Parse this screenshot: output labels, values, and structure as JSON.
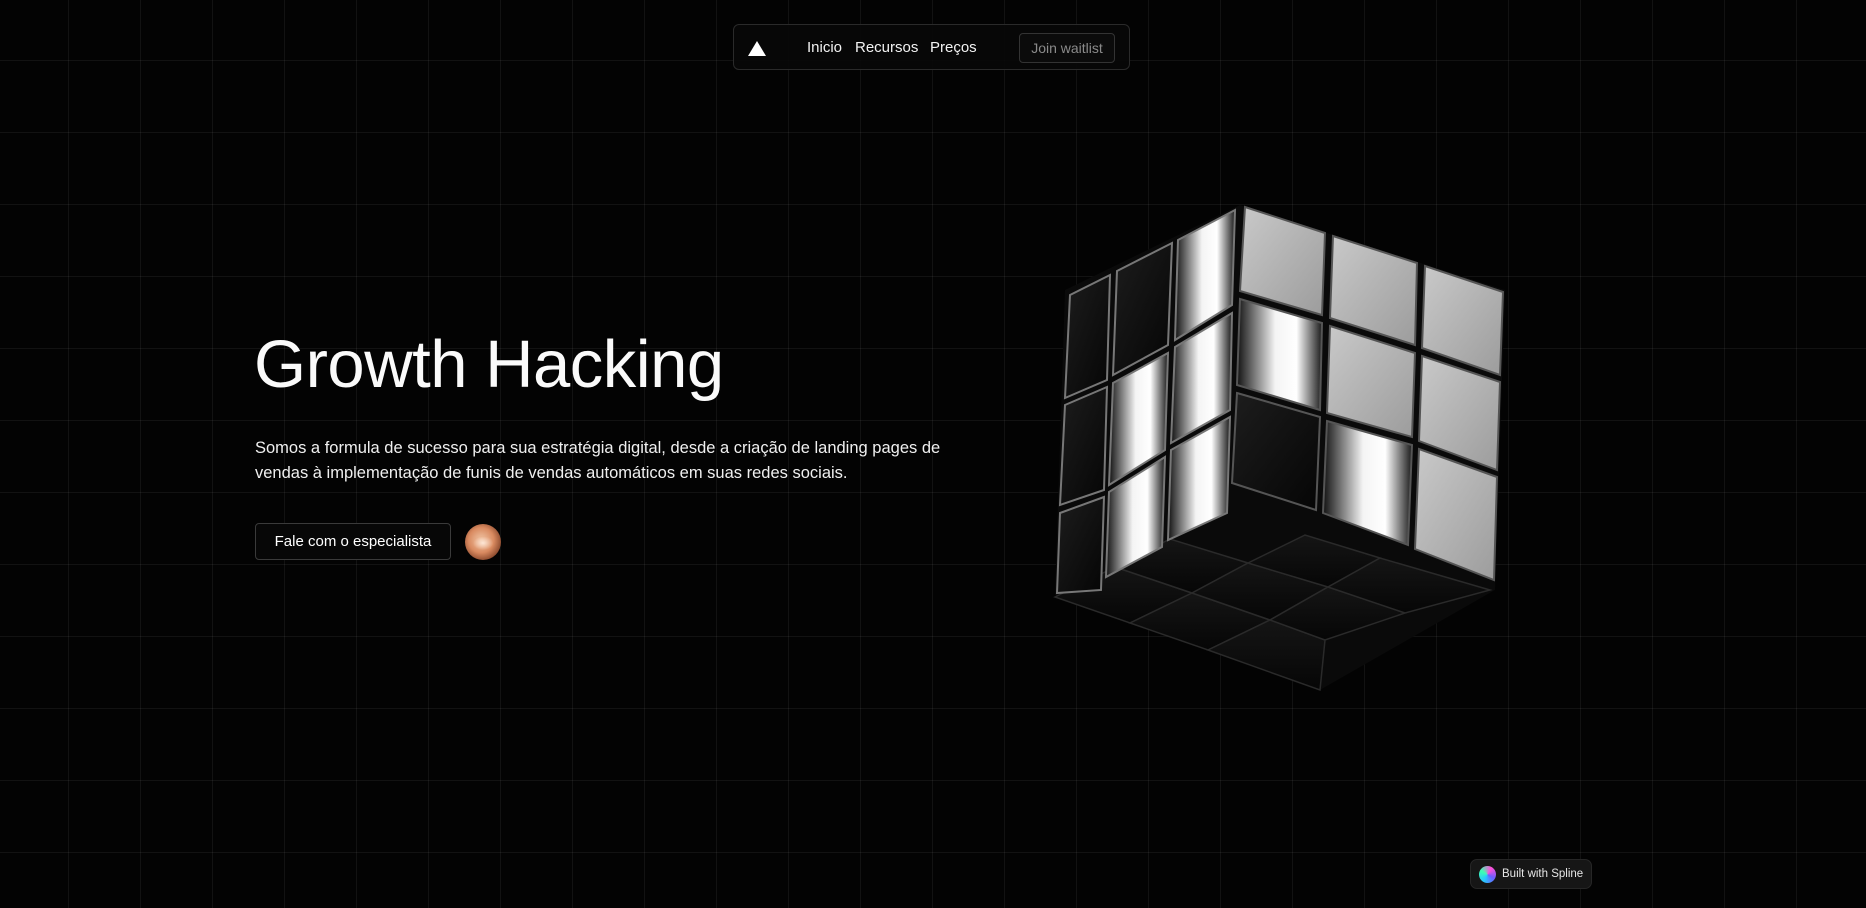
{
  "nav": {
    "logo_icon": "triangle-logo-icon",
    "links": [
      "Inicio",
      "Recursos",
      "Preços"
    ],
    "waitlist_label": "Join waitlist"
  },
  "hero": {
    "title": "Growth Hacking",
    "description": "Somos a formula de sucesso para sua estratégia digital, desde a criação de landing pages de vendas à implementação de funis de vendas automáticos em suas redes sociais.",
    "cta_label": "Fale com o especialista"
  },
  "badge": {
    "label": "Built with Spline",
    "icon": "spline-logo-icon"
  },
  "colors": {
    "background": "#030303",
    "text": "#ffffff",
    "muted": "#8a8a8a",
    "border": "#2a2a2a"
  }
}
